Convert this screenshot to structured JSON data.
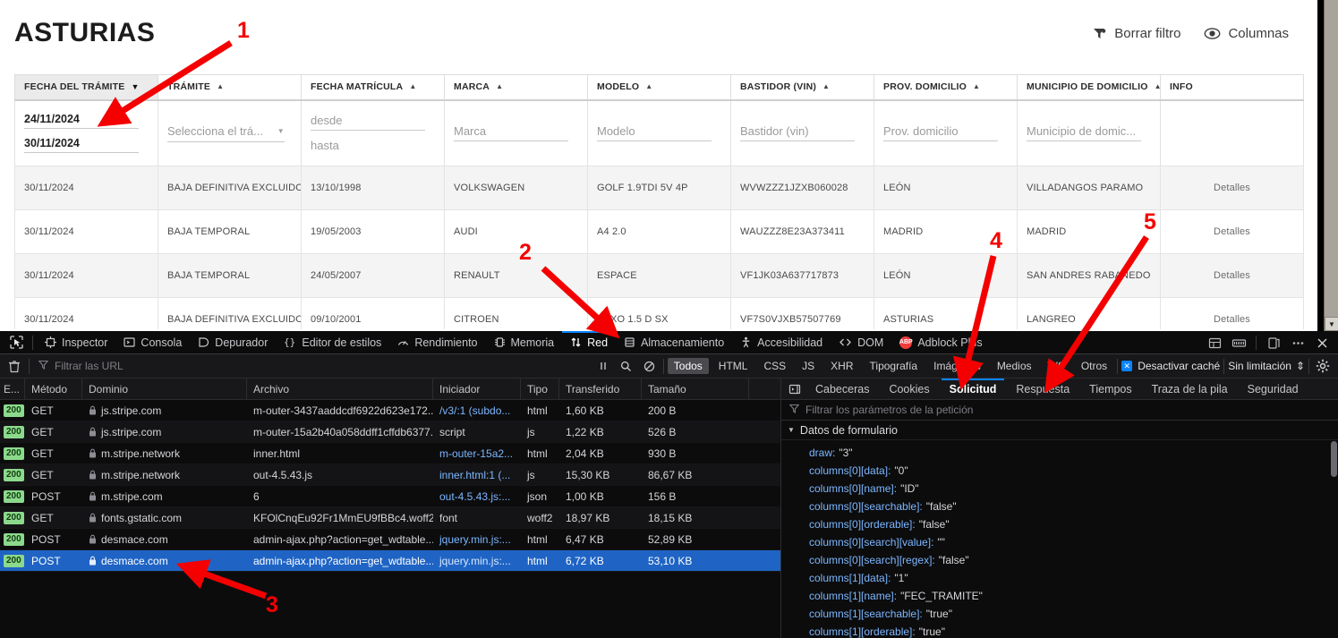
{
  "page": {
    "title": "ASTURIAS",
    "actions": [
      {
        "label": "Borrar filtro",
        "icon": "filter-clear-icon"
      },
      {
        "label": "Columnas",
        "icon": "eye-icon"
      }
    ],
    "table": {
      "columns": [
        {
          "label": "FECHA DEL TRÁMITE",
          "sort": "desc"
        },
        {
          "label": "TRÁMITE",
          "sort": "asc"
        },
        {
          "label": "FECHA MATRÍCULA",
          "sort": "asc"
        },
        {
          "label": "MARCA",
          "sort": "asc"
        },
        {
          "label": "MODELO",
          "sort": "asc"
        },
        {
          "label": "BASTIDOR (VIN)",
          "sort": "asc"
        },
        {
          "label": "PROV. DOMICILIO",
          "sort": "asc"
        },
        {
          "label": "MUNICIPIO DE DOMICILIO",
          "sort": "asc"
        },
        {
          "label": "INFO",
          "sort": "none"
        }
      ],
      "filters": {
        "fecha_tramite_desde": "24/11/2024",
        "fecha_tramite_hasta": "30/11/2024",
        "tramite_placeholder": "Selecciona el trá...",
        "fecha_matricula_desde_placeholder": "desde",
        "fecha_matricula_hasta_placeholder": "hasta",
        "marca_placeholder": "Marca",
        "modelo_placeholder": "Modelo",
        "bastidor_placeholder": "Bastidor (vin)",
        "prov_domicilio_placeholder": "Prov. domicilio",
        "municipio_placeholder": "Municipio de domic...",
        "info_placeholder": ""
      },
      "rows": [
        {
          "fecha_tramite": "30/11/2024",
          "tramite": "BAJA DEFINITIVA EXCLUIDO...",
          "fecha_matricula": "13/10/1998",
          "marca": "VOLKSWAGEN",
          "modelo": "GOLF 1.9TDI 5V 4P",
          "bastidor": "WVWZZZ1JZXB060028",
          "prov_domicilio": "LEÓN",
          "municipio": "VILLADANGOS PARAMO",
          "info": "Detalles"
        },
        {
          "fecha_tramite": "30/11/2024",
          "tramite": "BAJA TEMPORAL",
          "fecha_matricula": "19/05/2003",
          "marca": "AUDI",
          "modelo": "A4 2.0",
          "bastidor": "WAUZZZ8E23A373411",
          "prov_domicilio": "MADRID",
          "municipio": "MADRID",
          "info": "Detalles"
        },
        {
          "fecha_tramite": "30/11/2024",
          "tramite": "BAJA TEMPORAL",
          "fecha_matricula": "24/05/2007",
          "marca": "RENAULT",
          "modelo": "ESPACE",
          "bastidor": "VF1JK03A637717873",
          "prov_domicilio": "LEÓN",
          "municipio": "SAN ANDRES RABANEDO",
          "info": "Detalles"
        },
        {
          "fecha_tramite": "30/11/2024",
          "tramite": "BAJA DEFINITIVA EXCLUIDO",
          "fecha_matricula": "09/10/2001",
          "marca": "CITROEN",
          "modelo": "SAXO 1.5 D SX",
          "bastidor": "VF7S0VJXB57507769",
          "prov_domicilio": "ASTURIAS",
          "municipio": "LANGREO",
          "info": "Detalles"
        }
      ]
    }
  },
  "annotations": [
    {
      "number": "1"
    },
    {
      "number": "2"
    },
    {
      "number": "3"
    },
    {
      "number": "4"
    },
    {
      "number": "5"
    }
  ],
  "devtools": {
    "picker_icon": "element-picker-icon",
    "tabs": [
      {
        "label": "Inspector",
        "icon": "inspector-icon",
        "active": false
      },
      {
        "label": "Consola",
        "icon": "console-icon",
        "active": false
      },
      {
        "label": "Depurador",
        "icon": "debugger-icon",
        "active": false
      },
      {
        "label": "Editor de estilos",
        "icon": "style-editor-icon",
        "active": false
      },
      {
        "label": "Rendimiento",
        "icon": "performance-icon",
        "active": false
      },
      {
        "label": "Memoria",
        "icon": "memory-icon",
        "active": false
      },
      {
        "label": "Red",
        "icon": "network-icon",
        "active": true
      },
      {
        "label": "Almacenamiento",
        "icon": "storage-icon",
        "active": false
      },
      {
        "label": "Accesibilidad",
        "icon": "accessibility-icon",
        "active": false
      },
      {
        "label": "DOM",
        "icon": "dom-icon",
        "active": false
      },
      {
        "label": "Adblock Plus",
        "icon": "adblock-plus-icon",
        "active": false
      }
    ],
    "top_right_icons": [
      "split-console-icon",
      "responsive-design-icon",
      "dock-side-icon",
      "more-options-icon",
      "close-devtools-icon"
    ],
    "network_toolbar": {
      "trash_icon": "trash-icon",
      "url_filter_placeholder": "Filtrar las URL",
      "pause_icon": "pause-icon",
      "search_icon": "search-icon",
      "block_icon": "block-icon",
      "type_filters": [
        "Todos",
        "HTML",
        "CSS",
        "JS",
        "XHR",
        "Tipografía",
        "Imágenes",
        "Medios",
        "WS",
        "Otros"
      ],
      "active_type_filter": "Todos",
      "disable_cache_label": "Desactivar caché",
      "disable_cache_checked": true,
      "throttling_label": "Sin limitación",
      "settings_icon": "gear-icon"
    },
    "requests": {
      "columns": [
        "E...",
        "Método",
        "Dominio",
        "Archivo",
        "Iniciador",
        "Tipo",
        "Transferido",
        "Tamaño"
      ],
      "rows": [
        {
          "status": "200",
          "method": "GET",
          "domain": "js.stripe.com",
          "file": "m-outer-3437aaddcdf6922d623e172...",
          "initiator": "/v3/:1 (subdo...",
          "type": "html",
          "transferred": "1,60 KB",
          "size": "200 B",
          "selected": false
        },
        {
          "status": "200",
          "method": "GET",
          "domain": "js.stripe.com",
          "file": "m-outer-15a2b40a058ddff1cffdb6377...",
          "initiator": "script",
          "type": "js",
          "transferred": "1,22 KB",
          "size": "526 B",
          "selected": false
        },
        {
          "status": "200",
          "method": "GET",
          "domain": "m.stripe.network",
          "file": "inner.html",
          "initiator": "m-outer-15a2...",
          "type": "html",
          "transferred": "2,04 KB",
          "size": "930 B",
          "selected": false
        },
        {
          "status": "200",
          "method": "GET",
          "domain": "m.stripe.network",
          "file": "out-4.5.43.js",
          "initiator": "inner.html:1 (...",
          "type": "js",
          "transferred": "15,30 KB",
          "size": "86,67 KB",
          "selected": false
        },
        {
          "status": "200",
          "method": "POST",
          "domain": "m.stripe.com",
          "file": "6",
          "initiator": "out-4.5.43.js:...",
          "type": "json",
          "transferred": "1,00 KB",
          "size": "156 B",
          "selected": false
        },
        {
          "status": "200",
          "method": "GET",
          "domain": "fonts.gstatic.com",
          "file": "KFOlCnqEu92Fr1MmEU9fBBc4.woff2",
          "initiator": "font",
          "type": "woff2",
          "transferred": "18,97 KB",
          "size": "18,15 KB",
          "selected": false
        },
        {
          "status": "200",
          "method": "POST",
          "domain": "desmace.com",
          "file": "admin-ajax.php?action=get_wdtable...",
          "initiator": "jquery.min.js:...",
          "type": "html",
          "transferred": "6,47 KB",
          "size": "52,89 KB",
          "selected": false
        },
        {
          "status": "200",
          "method": "POST",
          "domain": "desmace.com",
          "file": "admin-ajax.php?action=get_wdtable...",
          "initiator": "jquery.min.js:...",
          "type": "html",
          "transferred": "6,72 KB",
          "size": "53,10 KB",
          "selected": true
        }
      ]
    },
    "detail": {
      "toggle_icon": "expand-pane-icon",
      "tabs": [
        {
          "label": "Cabeceras",
          "active": false
        },
        {
          "label": "Cookies",
          "active": false
        },
        {
          "label": "Solicitud",
          "active": true
        },
        {
          "label": "Respuesta",
          "active": false
        },
        {
          "label": "Tiempos",
          "active": false
        },
        {
          "label": "Traza de la pila",
          "active": false
        },
        {
          "label": "Seguridad",
          "active": false
        }
      ],
      "filter_placeholder": "Filtrar los parámetros de la petición",
      "section_label": "Datos de formulario",
      "params": [
        {
          "key": "draw",
          "value": "\"3\""
        },
        {
          "key": "columns[0][data]",
          "value": "\"0\""
        },
        {
          "key": "columns[0][name]",
          "value": "\"ID\""
        },
        {
          "key": "columns[0][searchable]",
          "value": "\"false\""
        },
        {
          "key": "columns[0][orderable]",
          "value": "\"false\""
        },
        {
          "key": "columns[0][search][value]",
          "value": "\"\""
        },
        {
          "key": "columns[0][search][regex]",
          "value": "\"false\""
        },
        {
          "key": "columns[1][data]",
          "value": "\"1\""
        },
        {
          "key": "columns[1][name]",
          "value": "\"FEC_TRAMITE\""
        },
        {
          "key": "columns[1][searchable]",
          "value": "\"true\""
        },
        {
          "key": "columns[1][orderable]",
          "value": "\"true\""
        }
      ]
    }
  },
  "colors": {
    "accent": "#0a84ff",
    "annotation": "#f40000",
    "selected_row": "#1f64c4",
    "status_ok": "#8cd98c"
  }
}
